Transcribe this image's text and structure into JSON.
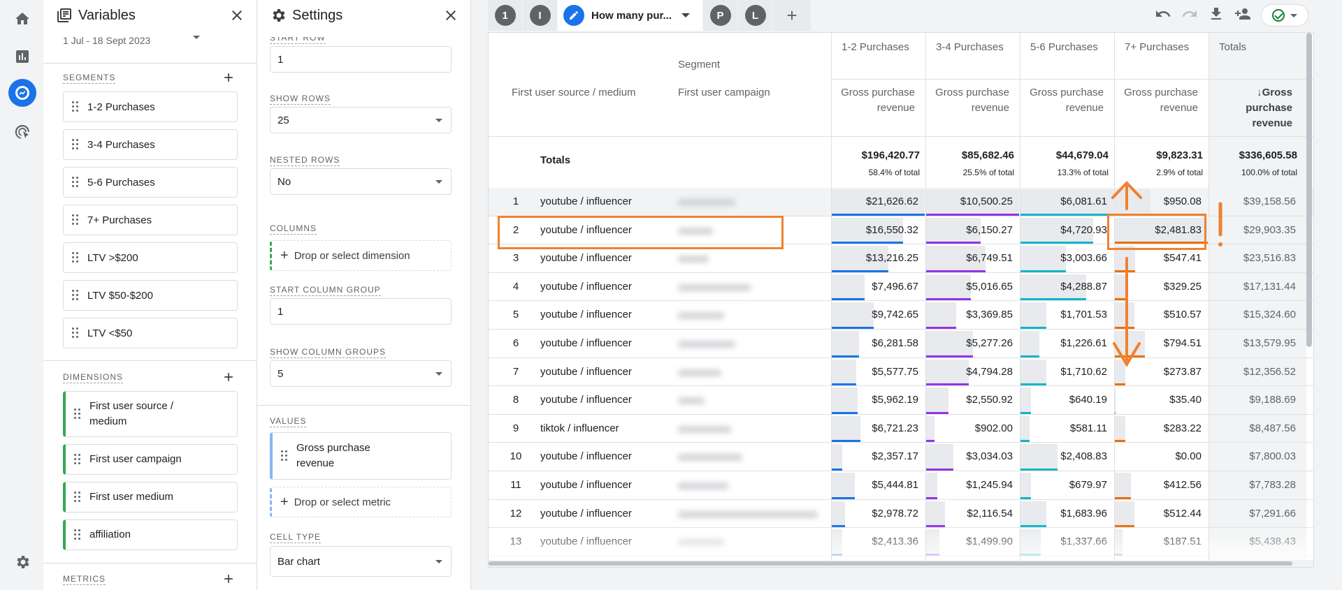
{
  "variables": {
    "title": "Variables",
    "date_range": "1 Jul - 18 Sept 2023",
    "segments_label": "SEGMENTS",
    "segments": [
      "1-2 Purchases",
      "3-4 Purchases",
      "5-6 Purchases",
      "7+ Purchases",
      "LTV >$200",
      "LTV $50-$200",
      "LTV <$50"
    ],
    "dimensions_label": "DIMENSIONS",
    "dimensions": [
      "First user source / medium",
      "First user campaign",
      "First user medium",
      "affiliation"
    ],
    "metrics_label": "METRICS"
  },
  "settings": {
    "title": "Settings",
    "start_row_label": "START ROW",
    "start_row": "1",
    "show_rows_label": "SHOW ROWS",
    "show_rows": "25",
    "nested_rows_label": "NESTED ROWS",
    "nested_rows": "No",
    "columns_label": "COLUMNS",
    "columns_drop": "Drop or select dimension",
    "start_col_group_label": "START COLUMN GROUP",
    "start_col_group": "1",
    "show_col_groups_label": "SHOW COLUMN GROUPS",
    "show_col_groups": "5",
    "values_label": "VALUES",
    "value_metric": "Gross purchase revenue",
    "values_drop": "Drop or select metric",
    "cell_type_label": "CELL TYPE",
    "cell_type": "Bar chart"
  },
  "tabs": {
    "items": [
      "1",
      "I"
    ],
    "active": "How many pur...",
    "after": [
      "P",
      "L"
    ],
    "add": "+"
  },
  "table": {
    "segment_header": "Segment",
    "dim1_header": "First user source / medium",
    "dim2_header": "First user campaign",
    "columns": [
      "1-2 Purchases",
      "3-4 Purchases",
      "5-6 Purchases",
      "7+ Purchases",
      "Totals"
    ],
    "metric_header": "Gross purchase revenue",
    "sort_arrow": "↓",
    "totals_label": "Totals",
    "totals": [
      "$196,420.77",
      "$85,682.46",
      "$44,679.04",
      "$9,823.31",
      "$336,605.58"
    ],
    "totals_pct": [
      "58.4% of total",
      "25.5% of total",
      "13.3% of total",
      "2.9% of total",
      "100.0% of total"
    ],
    "rows": [
      {
        "n": "1",
        "src": "youtube / influencer",
        "v": [
          "$21,626.62",
          "$10,500.25",
          "$6,081.61",
          "$950.08",
          "$39,158.56"
        ]
      },
      {
        "n": "2",
        "src": "youtube / influencer",
        "v": [
          "$16,550.32",
          "$6,150.27",
          "$4,720.93",
          "$2,481.83",
          "$29,903.35"
        ]
      },
      {
        "n": "3",
        "src": "youtube / influencer",
        "v": [
          "$13,216.25",
          "$6,749.51",
          "$3,003.66",
          "$547.41",
          "$23,516.83"
        ]
      },
      {
        "n": "4",
        "src": "youtube / influencer",
        "v": [
          "$7,496.67",
          "$5,016.65",
          "$4,288.87",
          "$329.25",
          "$17,131.44"
        ]
      },
      {
        "n": "5",
        "src": "youtube / influencer",
        "v": [
          "$9,742.65",
          "$3,369.85",
          "$1,701.53",
          "$510.57",
          "$15,324.60"
        ]
      },
      {
        "n": "6",
        "src": "youtube / influencer",
        "v": [
          "$6,281.58",
          "$5,277.26",
          "$1,226.61",
          "$794.51",
          "$13,579.95"
        ]
      },
      {
        "n": "7",
        "src": "youtube / influencer",
        "v": [
          "$5,577.75",
          "$4,794.28",
          "$1,710.62",
          "$273.87",
          "$12,356.52"
        ]
      },
      {
        "n": "8",
        "src": "youtube / influencer",
        "v": [
          "$5,962.19",
          "$2,550.92",
          "$640.19",
          "$35.40",
          "$9,188.69"
        ]
      },
      {
        "n": "9",
        "src": "tiktok / influencer",
        "v": [
          "$6,721.23",
          "$902.00",
          "$581.11",
          "$283.22",
          "$8,487.56"
        ]
      },
      {
        "n": "10",
        "src": "youtube / influencer",
        "v": [
          "$2,357.17",
          "$3,034.03",
          "$2,408.83",
          "$0.00",
          "$7,800.03"
        ]
      },
      {
        "n": "11",
        "src": "youtube / influencer",
        "v": [
          "$5,444.81",
          "$1,245.94",
          "$679.97",
          "$412.56",
          "$7,783.28"
        ]
      },
      {
        "n": "12",
        "src": "youtube / influencer",
        "v": [
          "$2,978.72",
          "$2,116.54",
          "$1,683.96",
          "$512.44",
          "$7,291.66"
        ]
      },
      {
        "n": "13",
        "src": "youtube / influencer",
        "v": [
          "$2,413.36",
          "$1,499.90",
          "$1,337.66",
          "$187.51",
          "$5,438.43"
        ]
      }
    ],
    "bar_fracs": [
      [
        1.0,
        1.0,
        1.0,
        0.38,
        1.0
      ],
      [
        0.77,
        0.59,
        0.78,
        1.0,
        0.76
      ],
      [
        0.61,
        0.64,
        0.49,
        0.22,
        0.6
      ],
      [
        0.35,
        0.48,
        0.71,
        0.13,
        0.44
      ],
      [
        0.45,
        0.32,
        0.28,
        0.21,
        0.39
      ],
      [
        0.29,
        0.5,
        0.2,
        0.32,
        0.35
      ],
      [
        0.26,
        0.46,
        0.28,
        0.11,
        0.32
      ],
      [
        0.28,
        0.24,
        0.11,
        0.01,
        0.23
      ],
      [
        0.31,
        0.09,
        0.1,
        0.11,
        0.22
      ],
      [
        0.11,
        0.29,
        0.4,
        0.0,
        0.2
      ],
      [
        0.25,
        0.12,
        0.11,
        0.17,
        0.2
      ],
      [
        0.14,
        0.2,
        0.28,
        0.21,
        0.19
      ],
      [
        0.11,
        0.14,
        0.22,
        0.08,
        0.14
      ]
    ]
  },
  "colors": {
    "segment_bars": [
      "#1a73e8",
      "#9334e6",
      "#12b5cb",
      "#e8710a",
      "#80868b"
    ],
    "annotation": "#f0812f",
    "accent": "#1a73e8"
  }
}
